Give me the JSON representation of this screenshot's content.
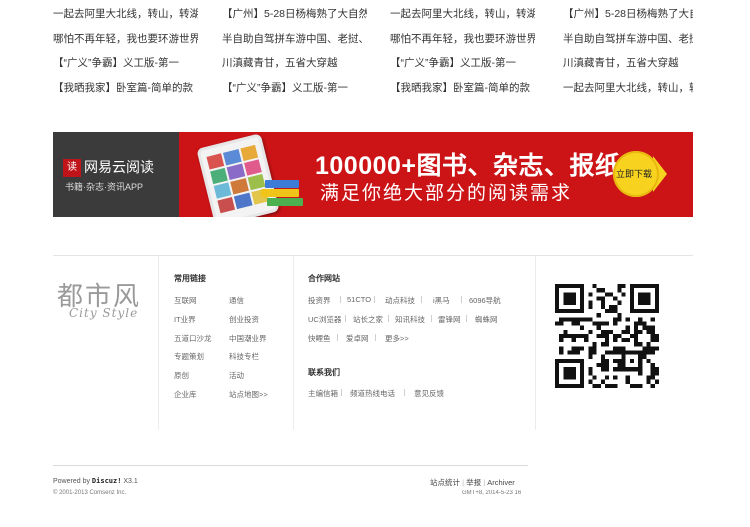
{
  "link_grid": {
    "col1": [
      "一起去阿里大北线，转山，转湖",
      "哪怕不再年轻，我也要环游世界",
      "【“广义”争霸】义工版-第一",
      "【我晒我家】卧室篇-简单的款"
    ],
    "col2": [
      "【广州】5-28日杨梅熟了大自然",
      "半自助自驾拼车游中国、老挝、",
      "川滇藏青甘，五省大穿越",
      "【“广义”争霸】义工版-第一"
    ],
    "col3": [
      "一起去阿里大北线，转山，转湖",
      "哪怕不再年轻，我也要环游世界",
      "【“广义”争霸】义工版-第一",
      "【我晒我家】卧室篇-简单的款"
    ],
    "col4": [
      "【广州】5-28日杨梅熟了大自然",
      "半自助自驾拼车游中国、老挝、",
      "川滇藏青甘，五省大穿越",
      "一起去阿里大北线，转山，转湖"
    ]
  },
  "banner": {
    "logo_mark": "读",
    "app_name": "网易云阅读",
    "app_subtitle": "书籍·杂志·资讯APP",
    "headline": "100000+图书、杂志、报纸",
    "tagline": "满足你绝大部分的阅读需求",
    "download_label": "立即下载",
    "colors": {
      "background": "#cc1417",
      "left_panel": "#3b3b3b",
      "button": "#f7d21e"
    }
  },
  "brand": {
    "title": "都市风",
    "subtitle": "City Style"
  },
  "common_links": {
    "heading": "常用链接",
    "items": [
      "互联网",
      "通信",
      "IT业界",
      "创业投资",
      "五道口沙龙",
      "中国潮业界",
      "专题策划",
      "科技专栏",
      "原创",
      "活动",
      "企业库",
      "站点地图>>"
    ]
  },
  "partner_sites": {
    "heading": "合作网站",
    "row1": [
      "投资界",
      "51CTO",
      "动点科技",
      "i黑马",
      "6096导航"
    ],
    "row2": [
      "UC浏览器",
      "站长之家",
      "知讯科技",
      "雷锋网",
      "蜘蛛网"
    ],
    "row3": [
      "快鲤鱼",
      "爱卓网",
      "更多>>"
    ]
  },
  "contact": {
    "heading": "联系我们",
    "items": [
      "主编信箱",
      "频道热线电话",
      "意见反馈"
    ]
  },
  "footer": {
    "powered_prefix": "Powered by",
    "powered_brand": "Discuz!",
    "powered_version": "X3.1",
    "copyright": "© 2001-2013 Comsenz Inc.",
    "links": [
      "站点统计",
      "举报",
      "Archiver"
    ],
    "gmt": "GMT+8, 2014-5-23 16"
  }
}
